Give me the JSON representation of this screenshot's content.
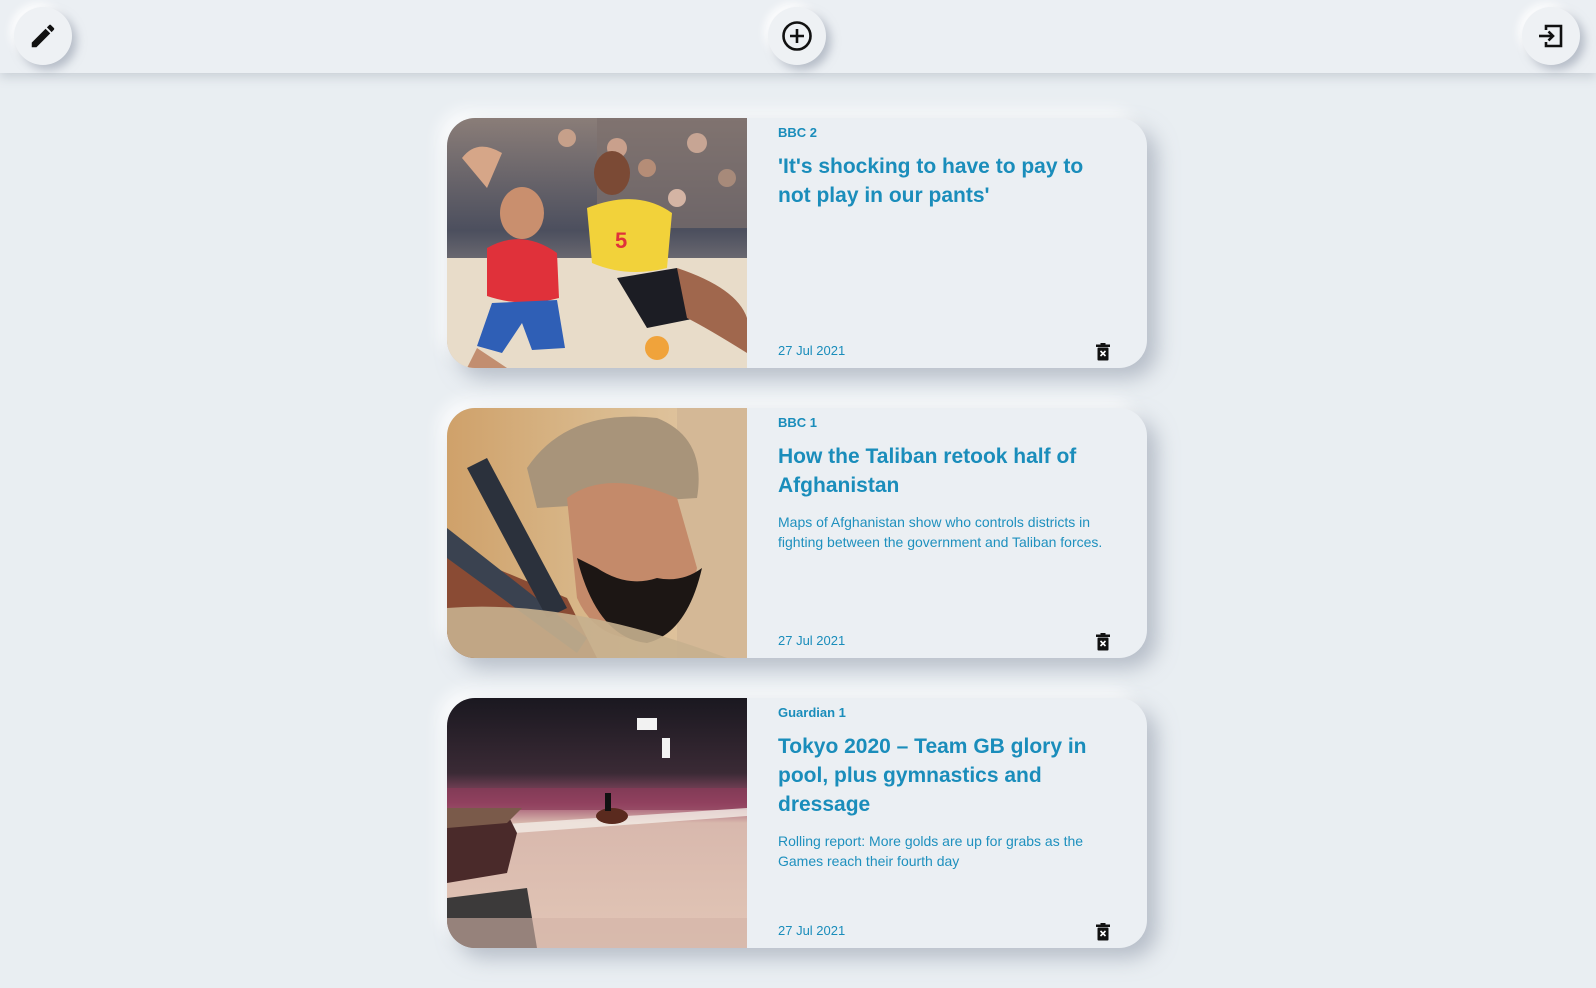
{
  "toolbar": {
    "edit_icon": "pencil-icon",
    "add_icon": "plus-circle-icon",
    "logout_icon": "exit-icon"
  },
  "articles": [
    {
      "source": "BBC 2",
      "title": "'It's shocking to have to pay to not play in our pants'",
      "description": "",
      "date": "27 Jul 2021",
      "image": "beach-handball-photo"
    },
    {
      "source": "BBC 1",
      "title": "How the Taliban retook half of Afghanistan",
      "description": "Maps of Afghanistan show who controls districts in fighting between the government and Taliban forces.",
      "date": "27 Jul 2021",
      "image": "taliban-fighter-photo"
    },
    {
      "source": "Guardian 1",
      "title": "Tokyo 2020 – Team GB glory in pool, plus gymnastics and dressage",
      "description": "Rolling report: More golds are up for grabs as the Games reach their fourth day",
      "date": "27 Jul 2021",
      "image": "dressage-arena-photo"
    }
  ],
  "colors": {
    "accent": "#1a8dbb",
    "background": "#e9eef2"
  }
}
